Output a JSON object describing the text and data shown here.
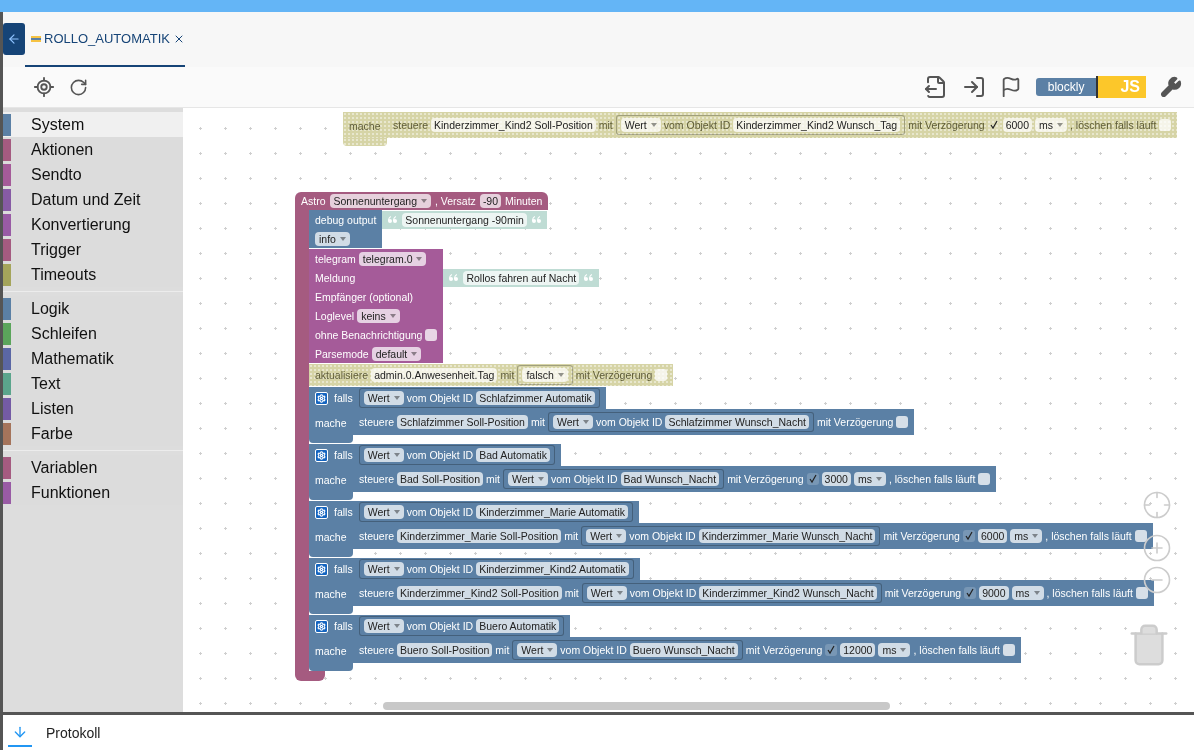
{
  "tab": {
    "label": "ROLLO_AUTOMATIK",
    "selected": true
  },
  "toolbar": {
    "blockly_label": "blockly",
    "js_label": "JS"
  },
  "sidebar": {
    "groups": [
      [
        {
          "label": "System",
          "color": "#5b80a5",
          "selected": true
        },
        {
          "label": "Aktionen",
          "color": "#a55b80",
          "selected": false
        },
        {
          "label": "Sendto",
          "color": "#a55b99",
          "selected": false
        },
        {
          "label": "Datum und Zeit",
          "color": "#875ba5",
          "selected": false
        },
        {
          "label": "Konvertierung",
          "color": "#995ba5",
          "selected": false
        },
        {
          "label": "Trigger",
          "color": "#a55b80",
          "selected": false
        },
        {
          "label": "Timeouts",
          "color": "#a5a55b",
          "selected": false
        }
      ],
      [
        {
          "label": "Logik",
          "color": "#5b80a5",
          "selected": false
        },
        {
          "label": "Schleifen",
          "color": "#5ba55b",
          "selected": false
        },
        {
          "label": "Mathematik",
          "color": "#5b67a5",
          "selected": false
        },
        {
          "label": "Text",
          "color": "#5ba58c",
          "selected": false
        },
        {
          "label": "Listen",
          "color": "#745ba5",
          "selected": false
        },
        {
          "label": "Farbe",
          "color": "#a5745b",
          "selected": false
        }
      ],
      [
        {
          "label": "Variablen",
          "color": "#a55b80",
          "selected": false
        },
        {
          "label": "Funktionen",
          "color": "#995ba5",
          "selected": false
        }
      ]
    ]
  },
  "workspace": {
    "blocks": [
      {
        "kind": "if",
        "disabled": true,
        "do_label": "mache",
        "do": {
          "kind": "statement",
          "disabled": true,
          "rows": [
            {
              "tokens": [
                {
                  "kind": "label",
                  "text": "steuere"
                },
                {
                  "kind": "field",
                  "text": "Kinderzimmer_Kind2 Soll-Position"
                },
                {
                  "kind": "label",
                  "text": "mit"
                },
                {
                  "kind": "value",
                  "tokens": [
                    {
                      "kind": "dropdown",
                      "text": "Wert"
                    },
                    {
                      "kind": "label",
                      "text": "vom Objekt ID"
                    },
                    {
                      "kind": "field",
                      "text": "Kinderzimmer_Kind2 Wunsch_Tag"
                    }
                  ]
                },
                {
                  "kind": "label",
                  "text": "mit Verzögerung"
                },
                {
                  "kind": "checkbox",
                  "checked": true
                },
                {
                  "kind": "field",
                  "text": "6000"
                },
                {
                  "kind": "dropdown",
                  "text": "ms"
                },
                {
                  "kind": "label",
                  "text": ", löschen falls läuft"
                },
                {
                  "kind": "checkbox",
                  "checked": false
                }
              ]
            }
          ]
        }
      },
      {
        "kind": "event",
        "color": "#a55b80",
        "disabled": false,
        "header": [
          {
            "kind": "label",
            "text": "Astro"
          },
          {
            "kind": "dropdown",
            "text": "Sonnenuntergang"
          },
          {
            "kind": "label",
            "text": ", Versatz"
          },
          {
            "kind": "field",
            "text": "-90"
          },
          {
            "kind": "label",
            "text": "Minuten"
          }
        ],
        "body": [
          {
            "kind": "statement",
            "color": "#5b80a5",
            "disabled": false,
            "rows": [
              {
                "tokens": [
                  {
                    "kind": "label",
                    "text": "debug output"
                  }
                ],
                "input": {
                  "kind": "string",
                  "text": "Sonnenuntergang -90min"
                }
              },
              {
                "tokens": [
                  {
                    "kind": "dropdown",
                    "text": "info"
                  }
                ]
              }
            ]
          },
          {
            "kind": "statement",
            "color": "#a55b99",
            "disabled": false,
            "rows": [
              {
                "tokens": [
                  {
                    "kind": "label",
                    "text": "telegram"
                  },
                  {
                    "kind": "dropdown",
                    "text": "telegram.0"
                  }
                ]
              },
              {
                "tokens": [
                  {
                    "kind": "label",
                    "text": "Meldung"
                  }
                ],
                "input": {
                  "kind": "string",
                  "text": "Rollos fahren auf Nacht"
                }
              },
              {
                "tokens": [
                  {
                    "kind": "label",
                    "text": "Empfänger (optional)"
                  }
                ]
              },
              {
                "tokens": [
                  {
                    "kind": "label",
                    "text": "Loglevel"
                  },
                  {
                    "kind": "dropdown",
                    "text": "keins"
                  }
                ]
              },
              {
                "tokens": [
                  {
                    "kind": "label",
                    "text": "ohne Benachrichtigung"
                  },
                  {
                    "kind": "checkbox",
                    "checked": false
                  }
                ]
              },
              {
                "tokens": [
                  {
                    "kind": "label",
                    "text": "Parsemode"
                  },
                  {
                    "kind": "dropdown",
                    "text": "default"
                  }
                ]
              }
            ]
          },
          {
            "kind": "statement",
            "disabled": true,
            "rows": [
              {
                "tokens": [
                  {
                    "kind": "label",
                    "text": "aktualisiere"
                  },
                  {
                    "kind": "field",
                    "text": "admin.0.Anwesenheit.Tag"
                  },
                  {
                    "kind": "label",
                    "text": "mit"
                  },
                  {
                    "kind": "value",
                    "tokens": [
                      {
                        "kind": "dropdown",
                        "text": "falsch"
                      }
                    ]
                  },
                  {
                    "kind": "label",
                    "text": "mit Verzögerung"
                  },
                  {
                    "kind": "checkbox",
                    "checked": false
                  }
                ]
              }
            ]
          },
          {
            "kind": "if",
            "color": "#5b80a5",
            "disabled": false,
            "condition": [
              {
                "kind": "label",
                "text": "falls"
              },
              {
                "kind": "value",
                "color": "#5b80a5",
                "tokens": [
                  {
                    "kind": "dropdown",
                    "text": "Wert"
                  },
                  {
                    "kind": "label",
                    "text": "vom Objekt ID"
                  },
                  {
                    "kind": "field",
                    "text": "Schlafzimmer Automatik"
                  }
                ]
              }
            ],
            "do_label": "mache",
            "do": {
              "kind": "statement",
              "color": "#5b80a5",
              "disabled": false,
              "rows": [
                {
                  "tokens": [
                    {
                      "kind": "label",
                      "text": "steuere"
                    },
                    {
                      "kind": "field",
                      "text": "Schlafzimmer Soll-Position"
                    },
                    {
                      "kind": "label",
                      "text": "mit"
                    },
                    {
                      "kind": "value",
                      "color": "#5b80a5",
                      "tokens": [
                        {
                          "kind": "dropdown",
                          "text": "Wert"
                        },
                        {
                          "kind": "label",
                          "text": "vom Objekt ID"
                        },
                        {
                          "kind": "field",
                          "text": "Schlafzimmer Wunsch_Nacht"
                        }
                      ]
                    },
                    {
                      "kind": "label",
                      "text": "mit Verzögerung"
                    },
                    {
                      "kind": "checkbox",
                      "checked": false
                    }
                  ]
                }
              ]
            }
          },
          {
            "kind": "if",
            "color": "#5b80a5",
            "disabled": false,
            "condition": [
              {
                "kind": "label",
                "text": "falls"
              },
              {
                "kind": "value",
                "color": "#5b80a5",
                "tokens": [
                  {
                    "kind": "dropdown",
                    "text": "Wert"
                  },
                  {
                    "kind": "label",
                    "text": "vom Objekt ID"
                  },
                  {
                    "kind": "field",
                    "text": "Bad Automatik"
                  }
                ]
              }
            ],
            "do_label": "mache",
            "do": {
              "kind": "statement",
              "color": "#5b80a5",
              "disabled": false,
              "rows": [
                {
                  "tokens": [
                    {
                      "kind": "label",
                      "text": "steuere"
                    },
                    {
                      "kind": "field",
                      "text": "Bad Soll-Position"
                    },
                    {
                      "kind": "label",
                      "text": "mit"
                    },
                    {
                      "kind": "value",
                      "color": "#5b80a5",
                      "tokens": [
                        {
                          "kind": "dropdown",
                          "text": "Wert"
                        },
                        {
                          "kind": "label",
                          "text": "vom Objekt ID"
                        },
                        {
                          "kind": "field",
                          "text": "Bad Wunsch_Nacht"
                        }
                      ]
                    },
                    {
                      "kind": "label",
                      "text": "mit Verzögerung"
                    },
                    {
                      "kind": "checkbox",
                      "checked": true
                    },
                    {
                      "kind": "field",
                      "text": "3000"
                    },
                    {
                      "kind": "dropdown",
                      "text": "ms"
                    },
                    {
                      "kind": "label",
                      "text": ", löschen falls läuft"
                    },
                    {
                      "kind": "checkbox",
                      "checked": false
                    }
                  ]
                }
              ]
            }
          },
          {
            "kind": "if",
            "color": "#5b80a5",
            "disabled": false,
            "condition": [
              {
                "kind": "label",
                "text": "falls"
              },
              {
                "kind": "value",
                "color": "#5b80a5",
                "tokens": [
                  {
                    "kind": "dropdown",
                    "text": "Wert"
                  },
                  {
                    "kind": "label",
                    "text": "vom Objekt ID"
                  },
                  {
                    "kind": "field",
                    "text": "Kinderzimmer_Marie Automatik"
                  }
                ]
              }
            ],
            "do_label": "mache",
            "do": {
              "kind": "statement",
              "color": "#5b80a5",
              "disabled": false,
              "rows": [
                {
                  "tokens": [
                    {
                      "kind": "label",
                      "text": "steuere"
                    },
                    {
                      "kind": "field",
                      "text": "Kinderzimmer_Marie Soll-Position"
                    },
                    {
                      "kind": "label",
                      "text": "mit"
                    },
                    {
                      "kind": "value",
                      "color": "#5b80a5",
                      "tokens": [
                        {
                          "kind": "dropdown",
                          "text": "Wert"
                        },
                        {
                          "kind": "label",
                          "text": "vom Objekt ID"
                        },
                        {
                          "kind": "field",
                          "text": "Kinderzimmer_Marie Wunsch_Nacht"
                        }
                      ]
                    },
                    {
                      "kind": "label",
                      "text": "mit Verzögerung"
                    },
                    {
                      "kind": "checkbox",
                      "checked": true
                    },
                    {
                      "kind": "field",
                      "text": "6000"
                    },
                    {
                      "kind": "dropdown",
                      "text": "ms"
                    },
                    {
                      "kind": "label",
                      "text": ", löschen falls läuft"
                    },
                    {
                      "kind": "checkbox",
                      "checked": false
                    }
                  ]
                }
              ]
            }
          },
          {
            "kind": "if",
            "color": "#5b80a5",
            "disabled": false,
            "condition": [
              {
                "kind": "label",
                "text": "falls"
              },
              {
                "kind": "value",
                "color": "#5b80a5",
                "tokens": [
                  {
                    "kind": "dropdown",
                    "text": "Wert"
                  },
                  {
                    "kind": "label",
                    "text": "vom Objekt ID"
                  },
                  {
                    "kind": "field",
                    "text": "Kinderzimmer_Kind2 Automatik"
                  }
                ]
              }
            ],
            "do_label": "mache",
            "do": {
              "kind": "statement",
              "color": "#5b80a5",
              "disabled": false,
              "rows": [
                {
                  "tokens": [
                    {
                      "kind": "label",
                      "text": "steuere"
                    },
                    {
                      "kind": "field",
                      "text": "Kinderzimmer_Kind2 Soll-Position"
                    },
                    {
                      "kind": "label",
                      "text": "mit"
                    },
                    {
                      "kind": "value",
                      "color": "#5b80a5",
                      "tokens": [
                        {
                          "kind": "dropdown",
                          "text": "Wert"
                        },
                        {
                          "kind": "label",
                          "text": "vom Objekt ID"
                        },
                        {
                          "kind": "field",
                          "text": "Kinderzimmer_Kind2 Wunsch_Nacht"
                        }
                      ]
                    },
                    {
                      "kind": "label",
                      "text": "mit Verzögerung"
                    },
                    {
                      "kind": "checkbox",
                      "checked": true
                    },
                    {
                      "kind": "field",
                      "text": "9000"
                    },
                    {
                      "kind": "dropdown",
                      "text": "ms"
                    },
                    {
                      "kind": "label",
                      "text": ", löschen falls läuft"
                    },
                    {
                      "kind": "checkbox",
                      "checked": false
                    }
                  ]
                }
              ]
            }
          },
          {
            "kind": "if",
            "color": "#5b80a5",
            "disabled": false,
            "condition": [
              {
                "kind": "label",
                "text": "falls"
              },
              {
                "kind": "value",
                "color": "#5b80a5",
                "tokens": [
                  {
                    "kind": "dropdown",
                    "text": "Wert"
                  },
                  {
                    "kind": "label",
                    "text": "vom Objekt ID"
                  },
                  {
                    "kind": "field",
                    "text": "Buero Automatik"
                  }
                ]
              }
            ],
            "do_label": "mache",
            "do": {
              "kind": "statement",
              "color": "#5b80a5",
              "disabled": false,
              "rows": [
                {
                  "tokens": [
                    {
                      "kind": "label",
                      "text": "steuere"
                    },
                    {
                      "kind": "field",
                      "text": "Buero Soll-Position"
                    },
                    {
                      "kind": "label",
                      "text": "mit"
                    },
                    {
                      "kind": "value",
                      "color": "#5b80a5",
                      "tokens": [
                        {
                          "kind": "dropdown",
                          "text": "Wert"
                        },
                        {
                          "kind": "label",
                          "text": "vom Objekt ID"
                        },
                        {
                          "kind": "field",
                          "text": "Buero Wunsch_Nacht"
                        }
                      ]
                    },
                    {
                      "kind": "label",
                      "text": "mit Verzögerung"
                    },
                    {
                      "kind": "checkbox",
                      "checked": true
                    },
                    {
                      "kind": "field",
                      "text": "12000"
                    },
                    {
                      "kind": "dropdown",
                      "text": "ms"
                    },
                    {
                      "kind": "label",
                      "text": ", löschen falls läuft"
                    },
                    {
                      "kind": "checkbox",
                      "checked": false
                    }
                  ]
                }
              ]
            }
          }
        ]
      }
    ]
  },
  "log_panel": {
    "label": "Protokoll"
  }
}
